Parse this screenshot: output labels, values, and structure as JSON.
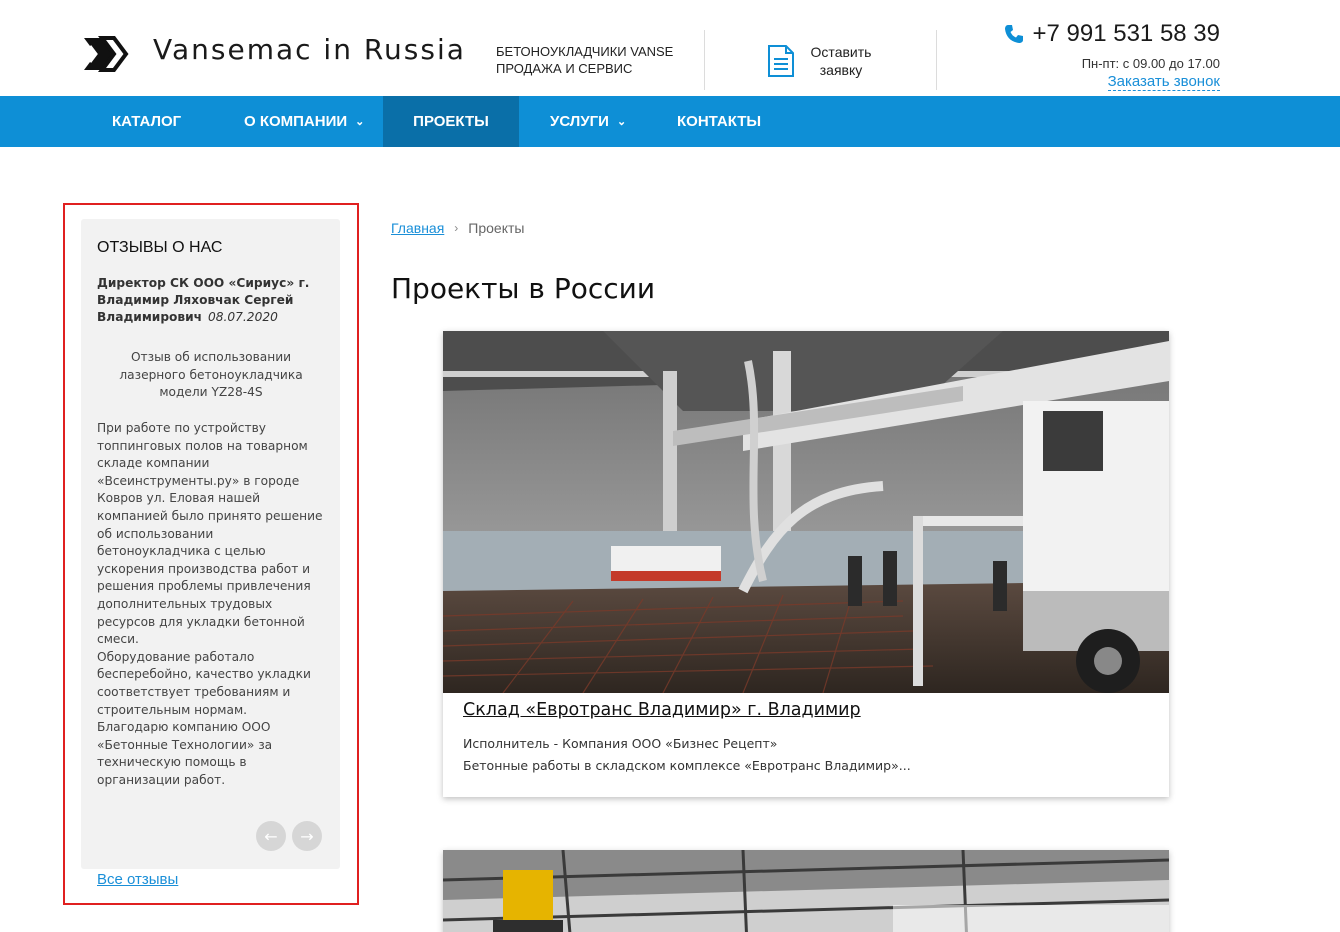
{
  "header": {
    "logo_text": "Vansemac in Russia",
    "tagline_line1": "БЕТОНОУКЛАДЧИКИ VANSE",
    "tagline_line2": "ПРОДАЖА И СЕРВИС",
    "request_label_line1": "Оставить",
    "request_label_line2": "заявку",
    "phone": "+7 991 531 58 39",
    "hours": "Пн-пт: с 09.00 до 17.00",
    "callback": "Заказать звонок"
  },
  "nav": {
    "items": [
      {
        "label": "КАТАЛОГ"
      },
      {
        "label": "О КОМПАНИИ"
      },
      {
        "label": "ПРОЕКТЫ"
      },
      {
        "label": "УСЛУГИ"
      },
      {
        "label": "КОНТАКТЫ"
      }
    ],
    "active": "ПРОЕКТЫ"
  },
  "sidebar": {
    "title": "ОТЗЫВЫ О НАС",
    "reviewer": "Директор СК ООО «Сириус» г. Владимир Ляховчак Сергей Владимирович",
    "date": "08.07.2020",
    "subject": "Отзыв об использовании лазерного бетоноукладчика модели YZ28-4S",
    "body": "При работе по устройству топпинговых полов на товарном складе компании «Всеинструменты.ру» в городе Ковров ул. Еловая нашей компанией было принято решение об использовании бетоноукладчика с целью ускорения производства работ и решения проблемы привлечения дополнительных трудовых ресурсов для укладки бетонной смеси.\nОборудование работало бесперебойно, качество укладки соответствует требованиям и строительным нормам.\nБлагодарю компанию ООО «Бетонные Технологии» за техническую помощь в организации работ.",
    "prev_icon": "←",
    "next_icon": "→",
    "all_reviews": "Все отзывы"
  },
  "breadcrumb": {
    "home": "Главная",
    "separator": "›",
    "current": "Проекты"
  },
  "page_title": "Проекты в России",
  "projects": [
    {
      "title": "Склад «Евротранс Владимир» г. Владимир",
      "line1": "Исполнитель - Компания ООО «Бизнес Рецепт»",
      "line2": "Бетонные работы в складском комплексе «Евротранс Владимир»..."
    }
  ],
  "colors": {
    "accent": "#0e8fd6",
    "accent_dark": "#0a6fa8",
    "link": "#1a8fd8",
    "highlight": "#e02020"
  }
}
